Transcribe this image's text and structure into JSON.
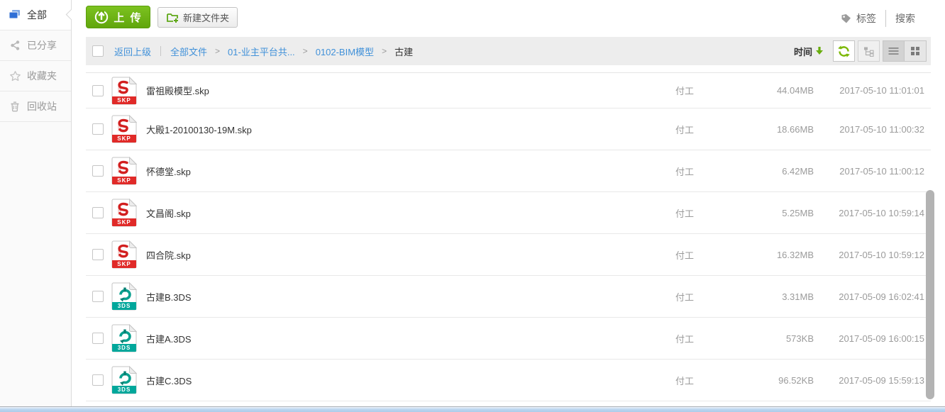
{
  "sidebar": {
    "items": [
      {
        "label": "全部",
        "icon": "folders-icon",
        "active": true
      },
      {
        "label": "已分享",
        "icon": "share-icon",
        "active": false
      },
      {
        "label": "收藏夹",
        "icon": "star-icon",
        "active": false
      },
      {
        "label": "回收站",
        "icon": "trash-icon",
        "active": false
      }
    ]
  },
  "toolbar": {
    "upload_label": "上 传",
    "new_folder_label": "新建文件夹",
    "tags_label": "标签",
    "search_label": "搜索"
  },
  "pathbar": {
    "back_label": "返回上级",
    "separator": ">",
    "crumbs": [
      {
        "label": "全部文件",
        "link": true
      },
      {
        "label": "01-业主平台共...",
        "link": true
      },
      {
        "label": "0102-BIM模型",
        "link": true
      },
      {
        "label": "古建",
        "link": false
      }
    ],
    "sort_label": "时间"
  },
  "files": [
    {
      "name": "雷祖殿模型.skp",
      "type": "skp",
      "badge": "SKP",
      "uploader": "付工",
      "size": "44.04MB",
      "date": "2017-05-10 11:01:01"
    },
    {
      "name": "大殿1-20100130-19M.skp",
      "type": "skp",
      "badge": "SKP",
      "uploader": "付工",
      "size": "18.66MB",
      "date": "2017-05-10 11:00:32"
    },
    {
      "name": "怀德堂.skp",
      "type": "skp",
      "badge": "SKP",
      "uploader": "付工",
      "size": "6.42MB",
      "date": "2017-05-10 11:00:12"
    },
    {
      "name": "文昌阁.skp",
      "type": "skp",
      "badge": "SKP",
      "uploader": "付工",
      "size": "5.25MB",
      "date": "2017-05-10 10:59:14"
    },
    {
      "name": "四合院.skp",
      "type": "skp",
      "badge": "SKP",
      "uploader": "付工",
      "size": "16.32MB",
      "date": "2017-05-10 10:59:12"
    },
    {
      "name": "古建B.3DS",
      "type": "3ds",
      "badge": "3DS",
      "uploader": "付工",
      "size": "3.31MB",
      "date": "2017-05-09 16:02:41"
    },
    {
      "name": "古建A.3DS",
      "type": "3ds",
      "badge": "3DS",
      "uploader": "付工",
      "size": "573KB",
      "date": "2017-05-09 16:00:15"
    },
    {
      "name": "古建C.3DS",
      "type": "3ds",
      "badge": "3DS",
      "uploader": "付工",
      "size": "96.52KB",
      "date": "2017-05-09 15:59:13"
    }
  ],
  "colors": {
    "accent_green": "#6cb112",
    "link_blue": "#4191d9",
    "skp_red": "#e02a28",
    "tds_teal": "#00a79b",
    "bar_gray": "#ededed"
  }
}
